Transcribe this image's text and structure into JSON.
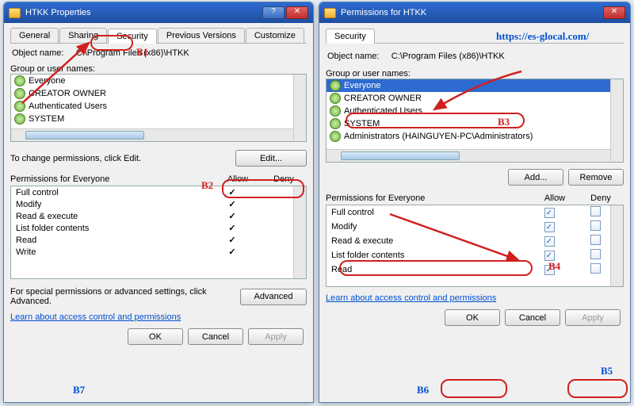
{
  "annotations": {
    "b1": "B1",
    "b2": "B2",
    "b3": "B3",
    "b4": "B4",
    "b5": "B5",
    "b6": "B6",
    "b7": "B7",
    "url": "https://es-glocal.com/"
  },
  "left": {
    "title": "HTKK Properties",
    "tabs": [
      "General",
      "Sharing",
      "Security",
      "Previous Versions",
      "Customize"
    ],
    "activeTab": 2,
    "objectLabel": "Object name:",
    "objectValue": "C:\\Program Files (x86)\\HTKK",
    "groupLabel": "Group or user names:",
    "users": [
      "Everyone",
      "CREATOR OWNER",
      "Authenticated Users",
      "SYSTEM"
    ],
    "changeText": "To change permissions, click Edit.",
    "editBtn": "Edit...",
    "permHeader": "Permissions for Everyone",
    "colAllow": "Allow",
    "colDeny": "Deny",
    "perms": [
      {
        "name": "Full control",
        "allow": false,
        "deny": false
      },
      {
        "name": "Modify",
        "allow": false,
        "deny": false
      },
      {
        "name": "Read & execute",
        "allow": true,
        "deny": false
      },
      {
        "name": "List folder contents",
        "allow": true,
        "deny": false
      },
      {
        "name": "Read",
        "allow": true,
        "deny": false
      },
      {
        "name": "Write",
        "allow": true,
        "deny": false
      }
    ],
    "advText": "For special permissions or advanced settings, click Advanced.",
    "advBtn": "Advanced",
    "link": "Learn about access control and permissions",
    "ok": "OK",
    "cancel": "Cancel",
    "apply": "Apply"
  },
  "right": {
    "title": "Permissions for HTKK",
    "tab": "Security",
    "objectLabel": "Object name:",
    "objectValue": "C:\\Program Files (x86)\\HTKK",
    "groupLabel": "Group or user names:",
    "users": [
      "Everyone",
      "CREATOR OWNER",
      "Authenticated Users",
      "SYSTEM",
      "Administrators (HAINGUYEN-PC\\Administrators)"
    ],
    "selectedUser": 0,
    "addBtn": "Add...",
    "removeBtn": "Remove",
    "permHeader": "Permissions for Everyone",
    "colAllow": "Allow",
    "colDeny": "Deny",
    "perms": [
      {
        "name": "Full control",
        "allow": true,
        "deny": false
      },
      {
        "name": "Modify",
        "allow": true,
        "deny": false
      },
      {
        "name": "Read & execute",
        "allow": true,
        "deny": false
      },
      {
        "name": "List folder contents",
        "allow": true,
        "deny": false
      },
      {
        "name": "Read",
        "allow": true,
        "deny": false
      }
    ],
    "link": "Learn about access control and permissions",
    "ok": "OK",
    "cancel": "Cancel",
    "apply": "Apply"
  }
}
